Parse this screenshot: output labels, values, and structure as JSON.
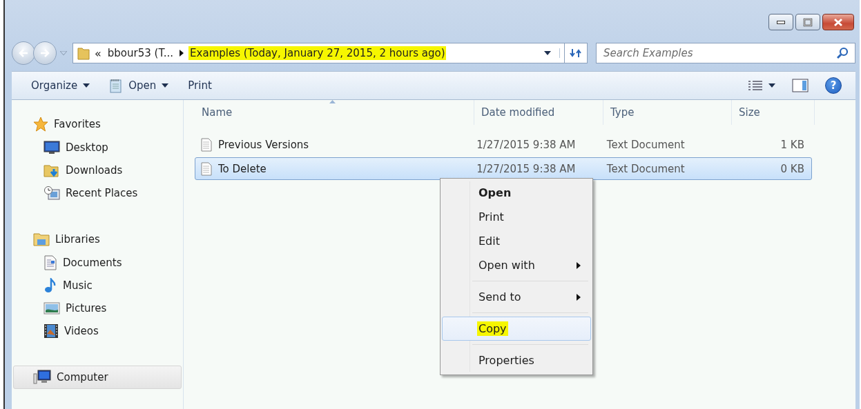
{
  "caption_buttons": [
    {
      "kind": "minimize"
    },
    {
      "kind": "maximize"
    },
    {
      "kind": "close"
    }
  ],
  "address_bar": {
    "prefix": "«",
    "crumbs": [
      {
        "label": "bbour53 (T...",
        "highlighted": false
      },
      {
        "label": "Examples (Today, January 27, 2015, 2 hours ago)",
        "highlighted": true
      }
    ]
  },
  "search": {
    "placeholder": "Search Examples"
  },
  "toolbar": {
    "items": [
      {
        "label": "Organize",
        "dropdown": true
      },
      {
        "label": "Open",
        "dropdown": true
      },
      {
        "label": "Print",
        "dropdown": false
      }
    ],
    "help": "?"
  },
  "sidebar": {
    "groups": [
      {
        "label": "Favorites",
        "selected": false,
        "children": [
          {
            "label": "Desktop"
          },
          {
            "label": "Downloads"
          },
          {
            "label": "Recent Places"
          }
        ]
      },
      {
        "label": "Libraries",
        "selected": false,
        "children": [
          {
            "label": "Documents"
          },
          {
            "label": "Music"
          },
          {
            "label": "Pictures"
          },
          {
            "label": "Videos"
          }
        ]
      },
      {
        "label": "Computer",
        "selected": true
      }
    ]
  },
  "table": {
    "columns": [
      "Name",
      "Date modified",
      "Type",
      "Size"
    ],
    "rows": [
      {
        "name": "Previous Versions",
        "date": "1/27/2015 9:38 AM",
        "type": "Text Document",
        "size": "1 KB",
        "selected": false
      },
      {
        "name": "To Delete",
        "date": "1/27/2015 9:38 AM",
        "type": "Text Document",
        "size": "0 KB",
        "selected": true
      }
    ]
  },
  "context_menu": {
    "items": [
      {
        "kind": "item",
        "label": "Open",
        "bold": true,
        "submenu": false,
        "selected": false,
        "highlighted": false
      },
      {
        "kind": "item",
        "label": "Print",
        "bold": false,
        "submenu": false,
        "selected": false,
        "highlighted": false
      },
      {
        "kind": "item",
        "label": "Edit",
        "bold": false,
        "submenu": false,
        "selected": false,
        "highlighted": false
      },
      {
        "kind": "item",
        "label": "Open with",
        "bold": false,
        "submenu": true,
        "selected": false,
        "highlighted": false
      },
      {
        "kind": "separator"
      },
      {
        "kind": "item",
        "label": "Send to",
        "bold": false,
        "submenu": true,
        "selected": false,
        "highlighted": false
      },
      {
        "kind": "separator"
      },
      {
        "kind": "item",
        "label": "Copy",
        "bold": false,
        "submenu": false,
        "selected": true,
        "highlighted": true
      },
      {
        "kind": "separator"
      },
      {
        "kind": "item",
        "label": "Properties",
        "bold": false,
        "submenu": false,
        "selected": false,
        "highlighted": false
      }
    ]
  }
}
